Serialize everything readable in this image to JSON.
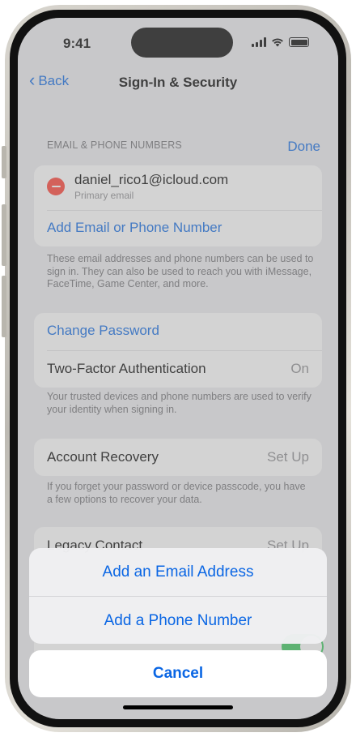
{
  "status_bar": {
    "time": "9:41"
  },
  "nav": {
    "back_label": "Back",
    "title": "Sign-In & Security"
  },
  "email_section": {
    "header": "EMAIL & PHONE NUMBERS",
    "done_label": "Done",
    "email": "daniel_rico1@icloud.com",
    "email_subtitle": "Primary email",
    "add_label": "Add Email or Phone Number",
    "footer": "These email addresses and phone numbers can be used to sign in. They can also be used to reach you with iMessage, FaceTime, Game Center, and more."
  },
  "security_section": {
    "change_password": "Change Password",
    "two_factor_label": "Two-Factor Authentication",
    "two_factor_value": "On",
    "footer": "Your trusted devices and phone numbers are used to verify your identity when signing in."
  },
  "recovery_section": {
    "label": "Account Recovery",
    "value": "Set Up",
    "footer": "If you forget your password or device passcode, you have a few options to recover your data."
  },
  "legacy_section": {
    "label": "Legacy Contact",
    "value": "Set Up"
  },
  "action_sheet": {
    "items": [
      "Add an Email Address",
      "Add a Phone Number"
    ],
    "cancel": "Cancel"
  },
  "colors": {
    "accent": "#0a66e4",
    "destructive": "#ff3b30",
    "toggle_on": "#34c759"
  },
  "icons": [
    "back-chevron-icon",
    "delete-icon",
    "signal-icon",
    "wifi-icon",
    "battery-icon"
  ]
}
